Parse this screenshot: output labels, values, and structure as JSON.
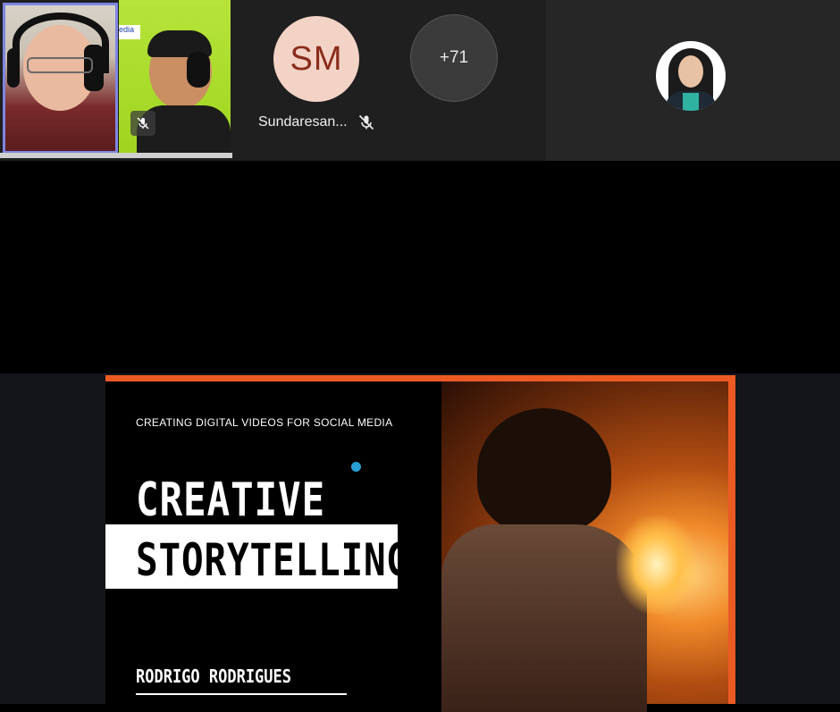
{
  "participants": {
    "active_speaker": {
      "role": "video"
    },
    "second_video": {
      "muted": true,
      "tile_label": "edia"
    },
    "sm": {
      "initials": "SM",
      "name": "Sundaresan...",
      "muted": true,
      "avatar_color": "#f3d3c5",
      "initials_color": "#8a2c1c"
    },
    "overflow": {
      "label": "+71"
    },
    "pinned_photo": {
      "type": "avatar-photo"
    }
  },
  "slide": {
    "subtitle": "CREATING DIGITAL VIDEOS FOR SOCIAL MEDIA",
    "title_line1": "CREATIVE",
    "title_line2": "STORYTELLING",
    "author": "RODRIGO RODRIGUES",
    "accent_color": "#ec5a24"
  },
  "colors": {
    "active_border": "#7f86e0",
    "top_bar": "#1f1f1f",
    "stage_dark": "#131519"
  }
}
